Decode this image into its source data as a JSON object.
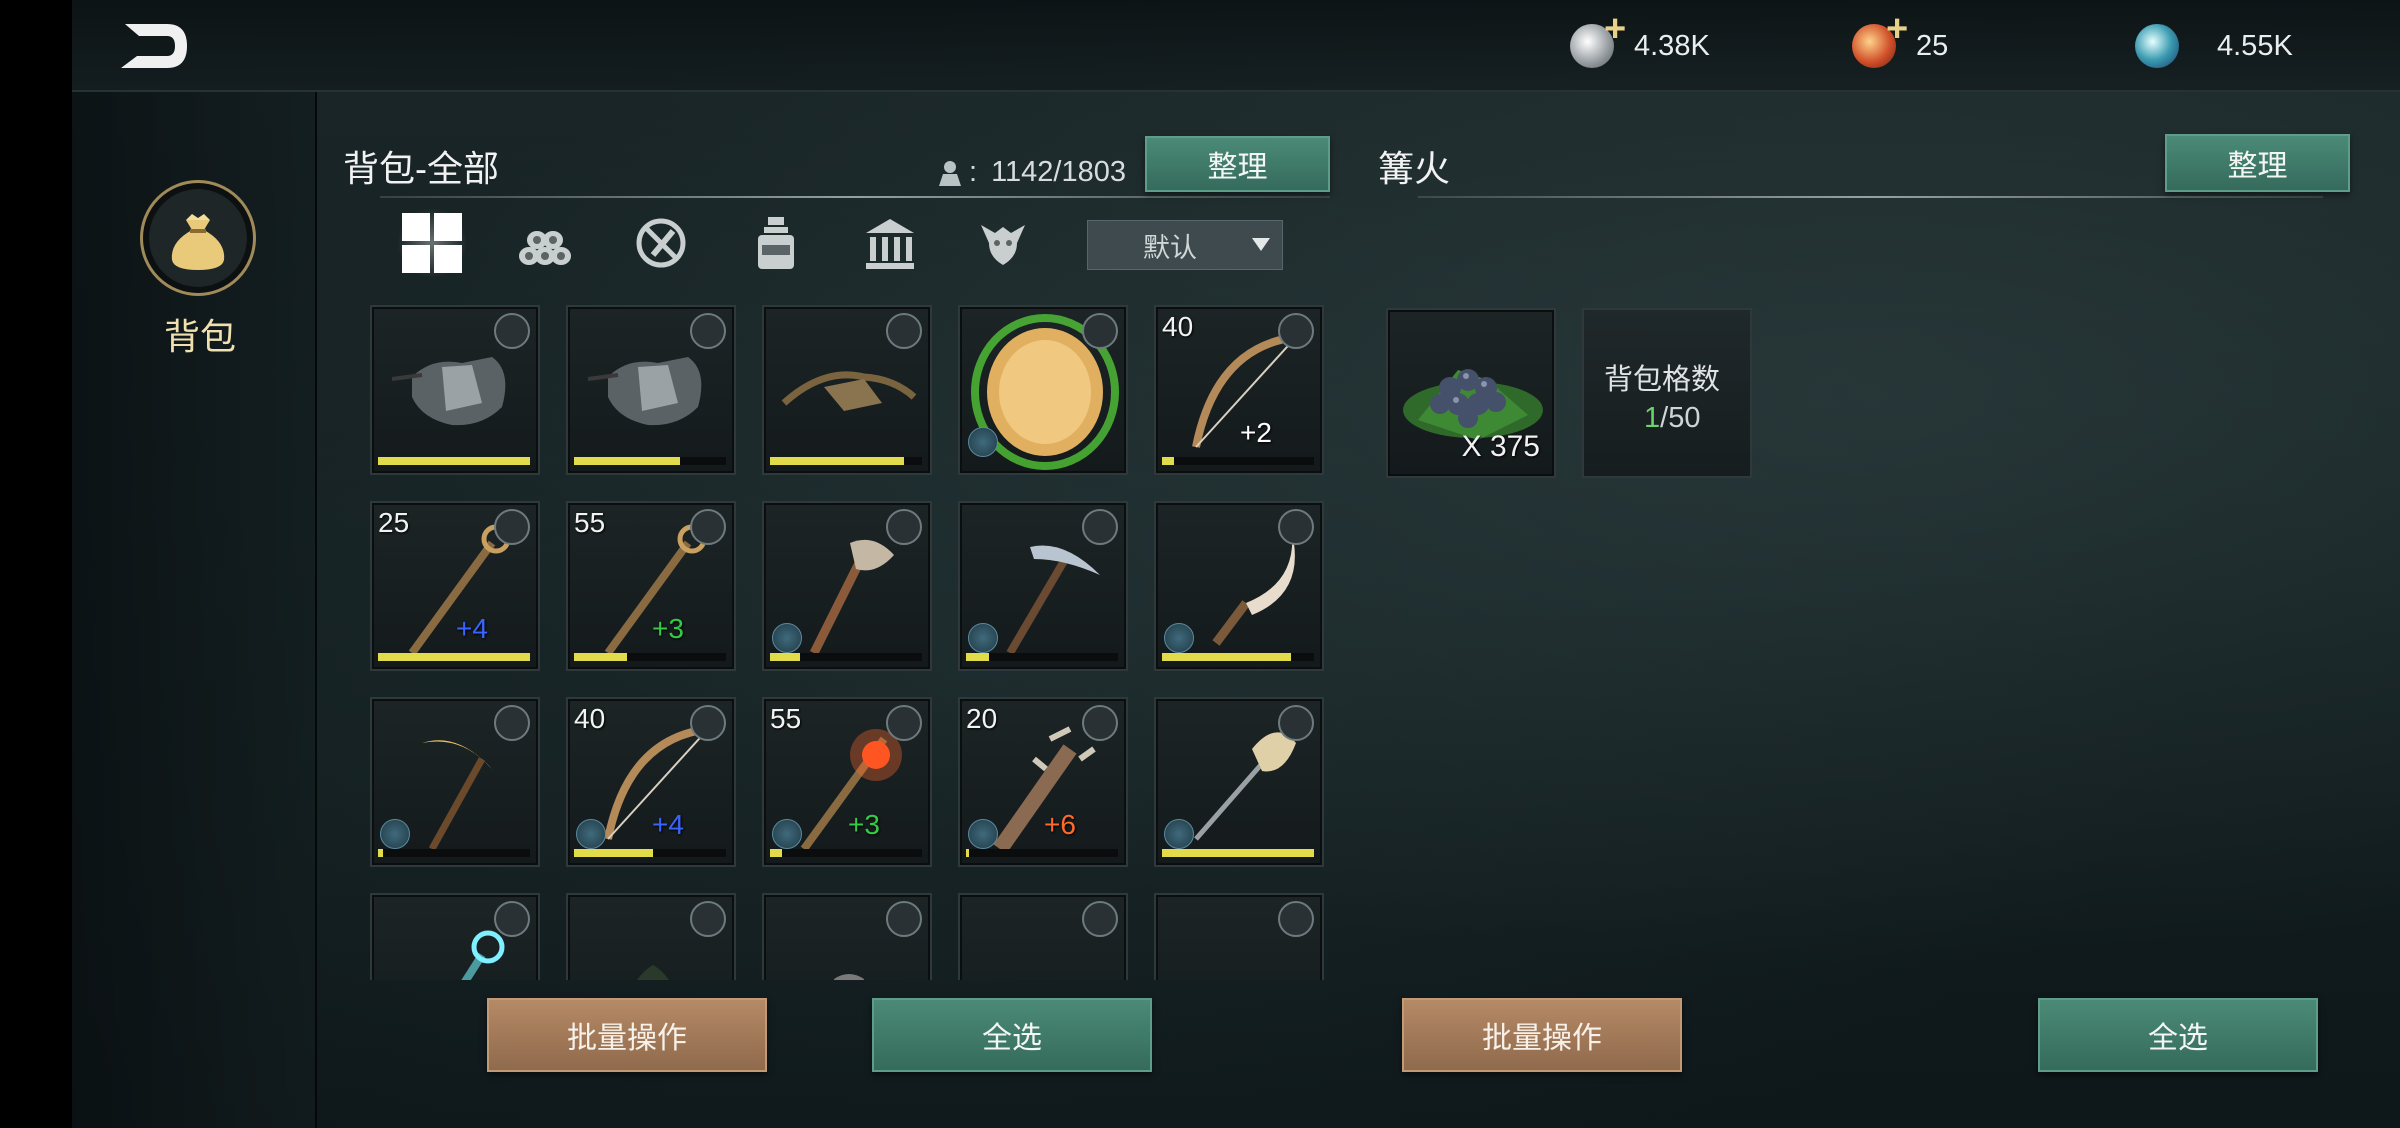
{
  "header": {
    "currencies": [
      {
        "icon": "silver-coin-icon",
        "value": "4.38K",
        "has_plus": true
      },
      {
        "icon": "copper-coin-icon",
        "value": "25",
        "has_plus": true
      },
      {
        "icon": "crystal-orb-icon",
        "value": "4.55K",
        "has_plus": false
      }
    ]
  },
  "sidebar": {
    "items": [
      {
        "label": "背包",
        "icon": "bag-icon"
      }
    ]
  },
  "inventory": {
    "title": "背包-全部",
    "capacity": "1142/1803",
    "sort_label": "整理",
    "filter_tabs": [
      {
        "icon": "grid-all-icon",
        "active": true
      },
      {
        "icon": "materials-logs-icon",
        "active": false
      },
      {
        "icon": "no-weapon-icon",
        "active": false
      },
      {
        "icon": "potion-bottle-icon",
        "active": false
      },
      {
        "icon": "building-icon",
        "active": false
      },
      {
        "icon": "creature-icon",
        "active": false
      }
    ],
    "sort_dropdown": {
      "selected": "默认"
    },
    "items": [
      {
        "name": "chest-armor-a",
        "level": "",
        "bonus": "",
        "bonus_color": "",
        "durability": 1.0,
        "wearable": false,
        "art": "armor"
      },
      {
        "name": "chest-armor-b",
        "level": "",
        "bonus": "",
        "bonus_color": "",
        "durability": 0.7,
        "wearable": false,
        "art": "armor"
      },
      {
        "name": "leather-pants",
        "level": "",
        "bonus": "",
        "bonus_color": "",
        "durability": 0.88,
        "wearable": false,
        "art": "pants"
      },
      {
        "name": "seed-disc",
        "level": "",
        "bonus": "",
        "bonus_color": "",
        "durability": null,
        "wearable": true,
        "art": "disc"
      },
      {
        "name": "bow-40",
        "level": "40",
        "bonus": "+2",
        "bonus_color": "#ffffff",
        "durability": 0.08,
        "wearable": false,
        "art": "bow"
      },
      {
        "name": "staff-25",
        "level": "25",
        "bonus": "+4",
        "bonus_color": "#3a64ff",
        "durability": 1.0,
        "wearable": false,
        "art": "staff"
      },
      {
        "name": "staff-55",
        "level": "55",
        "bonus": "+3",
        "bonus_color": "#33cc44",
        "durability": 0.35,
        "wearable": false,
        "art": "staff"
      },
      {
        "name": "axe",
        "level": "",
        "bonus": "",
        "bonus_color": "",
        "durability": 0.2,
        "wearable": true,
        "art": "axe"
      },
      {
        "name": "pickaxe",
        "level": "",
        "bonus": "",
        "bonus_color": "",
        "durability": 0.15,
        "wearable": true,
        "art": "pick"
      },
      {
        "name": "sickle",
        "level": "",
        "bonus": "",
        "bonus_color": "",
        "durability": 0.85,
        "wearable": true,
        "art": "sickle"
      },
      {
        "name": "scythe",
        "level": "",
        "bonus": "",
        "bonus_color": "",
        "durability": 0.03,
        "wearable": true,
        "art": "scythe"
      },
      {
        "name": "bow-40b",
        "level": "40",
        "bonus": "+4",
        "bonus_color": "#3a64ff",
        "durability": 0.52,
        "wearable": true,
        "art": "bow"
      },
      {
        "name": "staff-55b",
        "level": "55",
        "bonus": "+3",
        "bonus_color": "#33cc44",
        "durability": 0.08,
        "wearable": true,
        "art": "fire-staff"
      },
      {
        "name": "club-20",
        "level": "20",
        "bonus": "+6",
        "bonus_color": "#ff6a2a",
        "durability": 0.02,
        "wearable": true,
        "art": "club"
      },
      {
        "name": "shovel",
        "level": "",
        "bonus": "",
        "bonus_color": "",
        "durability": 1.0,
        "wearable": true,
        "art": "shovel"
      },
      {
        "name": "ice-staff",
        "level": "",
        "bonus": "",
        "bonus_color": "",
        "durability": null,
        "wearable": false,
        "art": "ice-staff"
      },
      {
        "name": "hood",
        "level": "",
        "bonus": "",
        "bonus_color": "",
        "durability": null,
        "wearable": false,
        "art": "hood"
      },
      {
        "name": "torso",
        "level": "",
        "bonus": "",
        "bonus_color": "",
        "durability": null,
        "wearable": false,
        "art": "torso"
      },
      {
        "name": "green-pants",
        "level": "",
        "bonus": "",
        "bonus_color": "",
        "durability": null,
        "wearable": false,
        "art": "green-pants"
      },
      {
        "name": "bracer",
        "level": "",
        "bonus": "",
        "bonus_color": "",
        "durability": null,
        "wearable": false,
        "art": "bracer"
      }
    ],
    "batch_label": "批量操作",
    "select_all_label": "全选"
  },
  "bonfire": {
    "title": "篝火",
    "sort_label": "整理",
    "item": {
      "quantity": "X 375",
      "art": "berries"
    },
    "capacity_title": "背包格数",
    "capacity_used": "1",
    "capacity_total": "/50",
    "batch_label": "批量操作",
    "select_all_label": "全选"
  },
  "colors": {
    "accent_green": "#3d7a69",
    "accent_brown": "#a07a5a",
    "durability_yellow": "#e3dc4a"
  }
}
